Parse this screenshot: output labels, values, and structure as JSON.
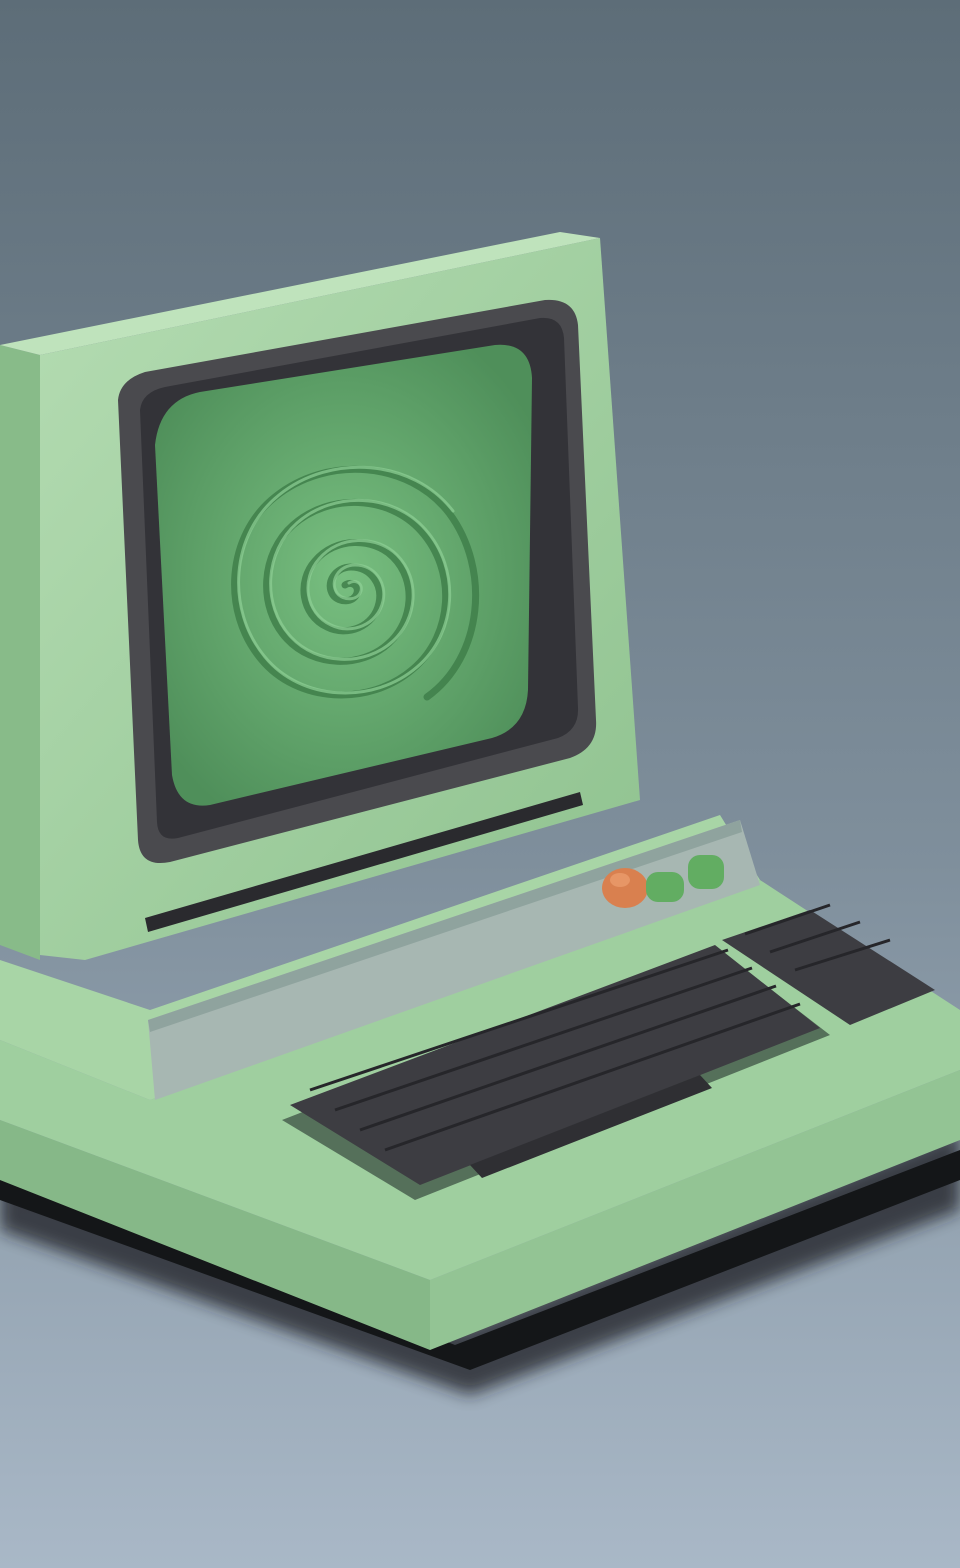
{
  "scene": {
    "subject": "clay-retro-computer",
    "colors": {
      "background_top": "#5d6d78",
      "background_mid": "#7f8f9c",
      "background_bottom": "#a9b8c7",
      "body_green": "#9ccc9c",
      "body_green_light": "#b4dcb2",
      "body_green_shadow": "#7fae82",
      "screen_green": "#6fb478",
      "screen_green_dark": "#4f8f5a",
      "bezel": "#4a4a4e",
      "bezel_dark": "#333338",
      "keys": "#3d3d42",
      "panel_grey": "#a7b7b2",
      "button_orange": "#d9804f",
      "button_green": "#62ad62",
      "floor_shadow": "#1b1e22"
    },
    "icons": {
      "screen_pattern": "spiral-icon",
      "power_button": "orange-button-icon",
      "buttons": [
        "green-button-icon",
        "green-button-icon"
      ]
    }
  }
}
